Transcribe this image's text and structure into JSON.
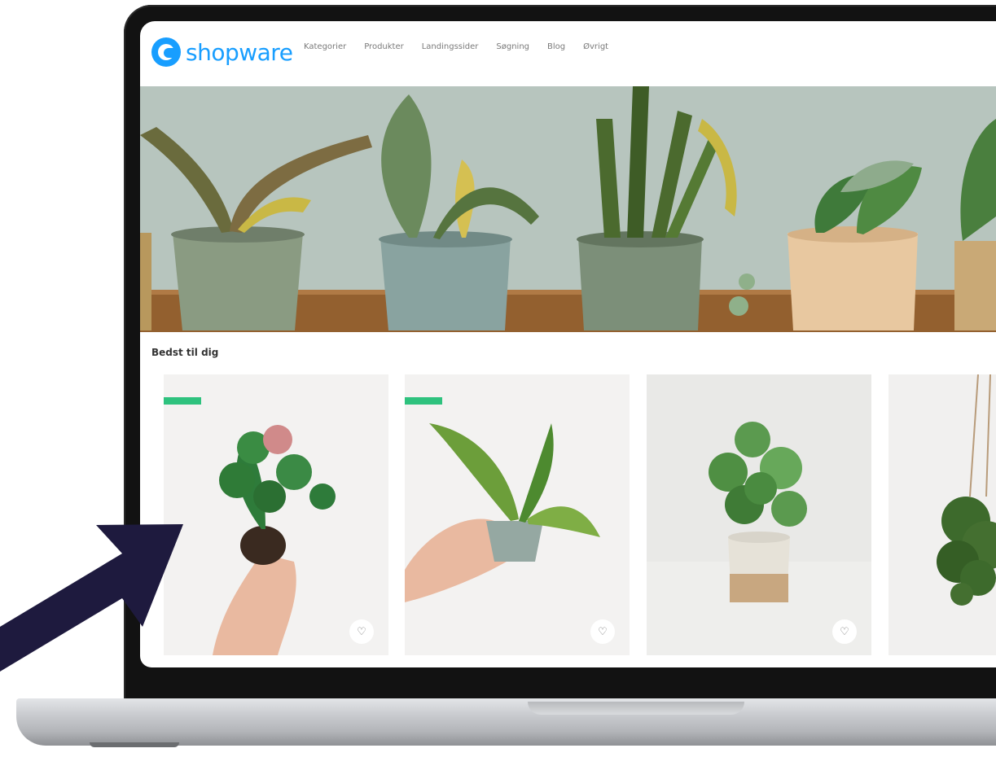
{
  "app": {
    "brand": "shopware",
    "brand_color": "#189eff"
  },
  "nav": {
    "items": [
      "Kategorier",
      "Produkter",
      "Landingssider",
      "Søgning",
      "Blog",
      "Øvrigt"
    ]
  },
  "section": {
    "title": "Bedst til dig"
  },
  "products": [
    {
      "badge": true,
      "wishlist_icon": "heart-outline-icon"
    },
    {
      "badge": true,
      "wishlist_icon": "heart-outline-icon"
    },
    {
      "badge": false,
      "wishlist_icon": "heart-outline-icon"
    },
    {
      "badge": false,
      "wishlist_icon": "heart-outline-icon"
    }
  ],
  "colors": {
    "badge": "#2ec27e",
    "arrow": "#1e1a3e",
    "card_bg": "#f2f2f1"
  }
}
